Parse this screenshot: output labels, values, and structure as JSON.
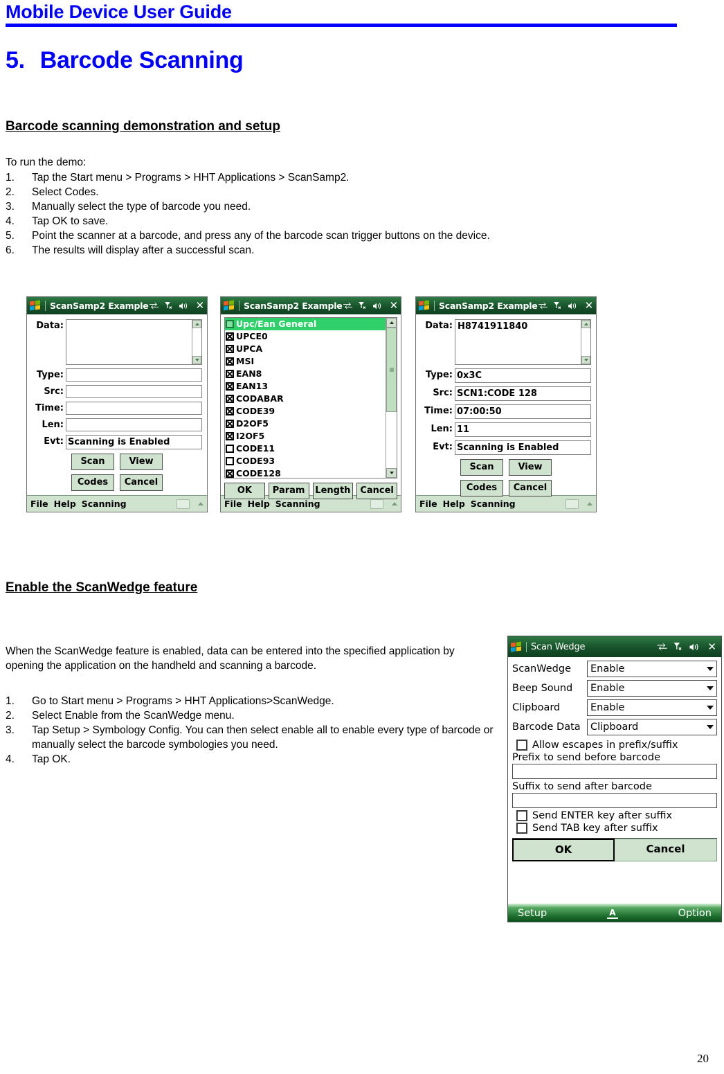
{
  "header": {
    "title": "Mobile Device User Guide"
  },
  "chapter": {
    "number": "5.",
    "title": "Barcode Scanning"
  },
  "sections": {
    "demo_heading": "Barcode scanning demonstration and setup",
    "wedge_heading": "Enable the ScanWedge feature"
  },
  "demo": {
    "intro": "To run the demo:",
    "steps": [
      {
        "num": "1.",
        "text": "Tap the Start menu > Programs > HHT Applications > ScanSamp2."
      },
      {
        "num": "2.",
        "text": "Select Codes."
      },
      {
        "num": "3.",
        "text": "Manually select the type of barcode you need."
      },
      {
        "num": "4.",
        "text": "Tap OK to save."
      },
      {
        "num": "5.",
        "text": "Point the scanner at a barcode, and press any of the barcode scan trigger buttons on the device."
      },
      {
        "num": "6.",
        "text": "The results will display after a successful scan."
      }
    ]
  },
  "wedge": {
    "paragraph": "When the ScanWedge feature is enabled, data can be entered into the specified application by opening the application on the handheld and scanning a barcode.",
    "steps": [
      {
        "num": "1.",
        "text": "Go to Start menu > Programs > HHT Applications>ScanWedge."
      },
      {
        "num": "2.",
        "text": "Select Enable from the ScanWedge menu."
      },
      {
        "num": "3.",
        "text": "Tap Setup > Symbology Config. You can then select enable all to enable every type of barcode or manually select the barcode symbologies you need."
      },
      {
        "num": "4.",
        "text": "Tap OK."
      }
    ]
  },
  "screenshot_empty": {
    "title": "ScanSamp2 Example",
    "fields": {
      "data_label": "Data:",
      "data_value": "",
      "type_label": "Type:",
      "type_value": "",
      "src_label": "Src:",
      "src_value": "",
      "time_label": "Time:",
      "time_value": "",
      "len_label": "Len:",
      "len_value": "",
      "evt_label": "Evt:",
      "evt_value": "Scanning is Enabled"
    },
    "buttons": {
      "scan": "Scan",
      "view": "View",
      "codes": "Codes",
      "cancel": "Cancel"
    },
    "menubar": {
      "file": "File",
      "help": "Help",
      "scanning": "Scanning"
    }
  },
  "screenshot_codes": {
    "title": "ScanSamp2 Example",
    "items": [
      {
        "label": "Upc/Ean General",
        "state": "group",
        "selected": true
      },
      {
        "label": "UPCE0",
        "state": "checked",
        "selected": false
      },
      {
        "label": "UPCA",
        "state": "checked",
        "selected": false
      },
      {
        "label": "MSI",
        "state": "checked",
        "selected": false
      },
      {
        "label": "EAN8",
        "state": "checked",
        "selected": false
      },
      {
        "label": "EAN13",
        "state": "checked",
        "selected": false
      },
      {
        "label": "CODABAR",
        "state": "checked",
        "selected": false
      },
      {
        "label": "CODE39",
        "state": "checked",
        "selected": false
      },
      {
        "label": "D2OF5",
        "state": "checked",
        "selected": false
      },
      {
        "label": "I2OF5",
        "state": "checked",
        "selected": false
      },
      {
        "label": "CODE11",
        "state": "unchecked",
        "selected": false
      },
      {
        "label": "CODE93",
        "state": "unchecked",
        "selected": false
      },
      {
        "label": "CODE128",
        "state": "checked",
        "selected": false
      }
    ],
    "buttons": {
      "ok": "OK",
      "param": "Param",
      "length": "Length",
      "cancel": "Cancel"
    },
    "menubar": {
      "file": "File",
      "help": "Help",
      "scanning": "Scanning"
    }
  },
  "screenshot_result": {
    "title": "ScanSamp2 Example",
    "fields": {
      "data_label": "Data:",
      "data_value": "H8741911840",
      "type_label": "Type:",
      "type_value": "0x3C",
      "src_label": "Src:",
      "src_value": "SCN1:CODE 128",
      "time_label": "Time:",
      "time_value": "07:00:50",
      "len_label": "Len:",
      "len_value": "11",
      "evt_label": "Evt:",
      "evt_value": "Scanning is Enabled"
    },
    "buttons": {
      "scan": "Scan",
      "view": "View",
      "codes": "Codes",
      "cancel": "Cancel"
    },
    "menubar": {
      "file": "File",
      "help": "Help",
      "scanning": "Scanning"
    }
  },
  "scanwedge_dialog": {
    "title": "Scan Wedge",
    "rows": [
      {
        "label": "ScanWedge",
        "value": "Enable"
      },
      {
        "label": "Beep Sound",
        "value": "Enable"
      },
      {
        "label": "Clipboard",
        "value": "Enable"
      },
      {
        "label": "Barcode Data",
        "value": "Clipboard"
      }
    ],
    "allow_escapes_label": "Allow escapes in prefix/suffix",
    "prefix_caption": "Prefix to send before barcode",
    "prefix_value": "",
    "suffix_caption": "Suffix to send after barcode",
    "suffix_value": "",
    "send_enter_label": "Send ENTER key after suffix",
    "send_tab_label": "Send TAB key after suffix",
    "ok_label": "OK",
    "cancel_label": "Cancel",
    "taskbar": {
      "setup": "Setup",
      "sip": "A",
      "option": "Option"
    }
  },
  "footer": {
    "page_number": "20"
  },
  "colors": {
    "heading_blue": "#0000FF",
    "titlebar_green": "#17522A",
    "button_green": "#CFE3CF",
    "selection_green": "#2FD06A"
  }
}
